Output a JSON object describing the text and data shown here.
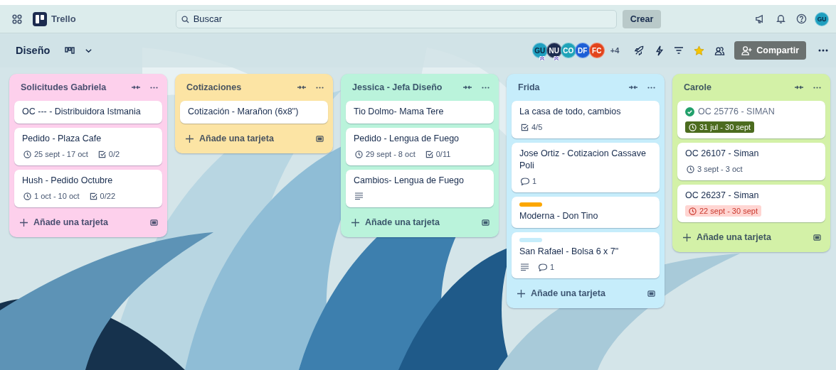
{
  "header": {
    "app_name": "Trello",
    "search": {
      "placeholder": "Buscar"
    },
    "create_button": "Crear",
    "user_avatar": {
      "initials": "GU",
      "color": "#1f9fbf"
    }
  },
  "board": {
    "title": "Diseño",
    "members": [
      {
        "initials": "GU",
        "color": "#1f9fbf",
        "admin": true
      },
      {
        "initials": "NU",
        "color": "#1c2b4f",
        "admin": true
      },
      {
        "initials": "CO",
        "color": "#1fa3b8",
        "admin": false
      },
      {
        "initials": "DF",
        "color": "#1d5fd6",
        "admin": false
      },
      {
        "initials": "FC",
        "color": "#e2441c",
        "admin": false
      }
    ],
    "extra_members": "+4",
    "starred": true,
    "share_button": "Compartir"
  },
  "lists": [
    {
      "title": "Solicitudes Gabriela",
      "color": "#fdd0ec",
      "add_card": "Añade una tarjeta",
      "cards": [
        {
          "title": "OC --- - Distribuidora Istmania",
          "complete": false
        },
        {
          "title": "Pedido - Plaza Cafe",
          "complete": false,
          "badges": [
            {
              "kind": "dates",
              "text": "25 sept - 17 oct",
              "complete": false,
              "overdue": false
            },
            {
              "kind": "checklist",
              "text": "0/2"
            }
          ]
        },
        {
          "title": "Hush - Pedido Octubre",
          "complete": false,
          "badges": [
            {
              "kind": "dates",
              "text": "1 oct - 10 oct",
              "complete": false,
              "overdue": false
            },
            {
              "kind": "checklist",
              "text": "0/22"
            }
          ]
        }
      ]
    },
    {
      "title": "Cotizaciones",
      "color": "#fce4a4",
      "add_card": "Añade una tarjeta",
      "cards": [
        {
          "title": "Cotización - Marañon (6x8'')",
          "complete": false
        }
      ]
    },
    {
      "title": "Jessica - Jefa Diseño",
      "color": "#baf3db",
      "add_card": "Añade una tarjeta",
      "cards": [
        {
          "title": "Tio Dolmo- Mama Tere",
          "complete": false
        },
        {
          "title": "Pedido - Lengua de Fuego",
          "complete": false,
          "badges": [
            {
              "kind": "dates",
              "text": "29 sept - 8 oct",
              "complete": false,
              "overdue": false
            },
            {
              "kind": "checklist",
              "text": "0/11"
            }
          ]
        },
        {
          "title": "Cambios- Lengua de Fuego",
          "complete": false,
          "badges": [
            {
              "kind": "description"
            }
          ]
        }
      ]
    },
    {
      "title": "Frida",
      "color": "#c6edfb",
      "add_card": "Añade una tarjeta",
      "cards": [
        {
          "title": "La casa de todo, cambios",
          "complete": false,
          "badges": [
            {
              "kind": "checklist",
              "text": "4/5"
            }
          ]
        },
        {
          "title": "Jose Ortiz - Cotizacion Cassave Poli",
          "complete": false,
          "badges": [
            {
              "kind": "comments",
              "text": "1"
            }
          ]
        },
        {
          "title": "Moderna - Don Tino",
          "complete": false,
          "labels": [
            {
              "color": "#fca700"
            }
          ]
        },
        {
          "title": "San Rafael - Bolsa 6 x 7\"",
          "complete": false,
          "labels": [
            {
              "color": "#c6edfb"
            }
          ],
          "badges": [
            {
              "kind": "description"
            },
            {
              "kind": "comments",
              "text": "1"
            }
          ]
        }
      ]
    },
    {
      "title": "Carole",
      "color": "#d3f1a7",
      "add_card": "Añade una tarjeta",
      "cards": [
        {
          "title": "OC 25776 - SIMAN",
          "complete": true,
          "badges": [
            {
              "kind": "dates",
              "text": "31 jul - 30 sept",
              "complete": true,
              "overdue": false
            }
          ]
        },
        {
          "title": "OC 26107 - Siman",
          "complete": false,
          "badges": [
            {
              "kind": "dates",
              "text": "3 sept - 3 oct",
              "complete": false,
              "overdue": false
            }
          ]
        },
        {
          "title": "OC 26237 - Siman",
          "complete": false,
          "badges": [
            {
              "kind": "dates",
              "text": "22 sept - 30 sept",
              "complete": false,
              "overdue": true
            }
          ]
        }
      ]
    }
  ]
}
